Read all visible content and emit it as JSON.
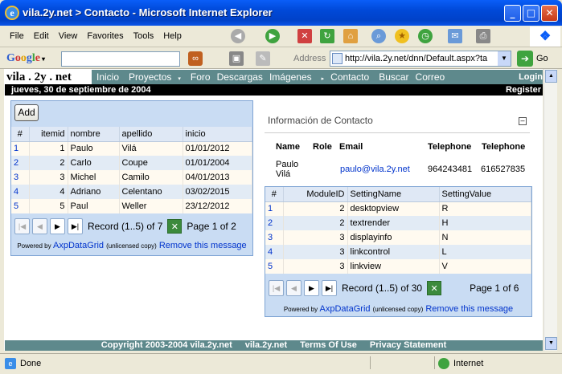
{
  "window": {
    "title": "vila.2y.net > Contacto - Microsoft Internet Explorer"
  },
  "menu": [
    "File",
    "Edit",
    "View",
    "Favorites",
    "Tools",
    "Help"
  ],
  "toolbar": {
    "google_label": "Google",
    "address_label": "Address",
    "address_value": "http://vila.2y.net/dnn/Default.aspx?ta",
    "go_label": "Go"
  },
  "site": {
    "name": "vila . 2y . net",
    "nav": [
      "Inicio",
      "Proyectos",
      "Foro",
      "Descargas",
      "Imágenes",
      "Contacto",
      "Buscar",
      "Correo"
    ],
    "login": "Login",
    "date": "jueves, 30 de septiembre de 2004",
    "register": "Register"
  },
  "left_grid": {
    "add_label": "Add",
    "columns": [
      "#",
      "itemid",
      "nombre",
      "apellido",
      "inicio"
    ],
    "rows": [
      [
        "1",
        "1",
        "Paulo",
        "Vilá",
        "01/01/2012"
      ],
      [
        "2",
        "2",
        "Carlo",
        "Coupe",
        "01/01/2004"
      ],
      [
        "3",
        "3",
        "Michel",
        "Camilo",
        "04/01/2013"
      ],
      [
        "4",
        "4",
        "Adriano",
        "Celentano",
        "03/02/2015"
      ],
      [
        "5",
        "5",
        "Paul",
        "Weller",
        "23/12/2012"
      ]
    ],
    "record_text": "Record (1..5) of 7",
    "page_text": "Page 1 of 2"
  },
  "powered": {
    "prefix": "Powered by",
    "product": "AxpDataGrid",
    "note": "(unlicensed copy)",
    "remove": "Remove this message"
  },
  "contact": {
    "title": "Información de Contacto",
    "headers": [
      "Name",
      "Role",
      "Email",
      "Telephone",
      "Telephone"
    ],
    "name_line1": "Paulo",
    "name_line2": "Vilá",
    "email": "paulo@vila.2y.net",
    "tel1": "964243481",
    "tel2": "616527835"
  },
  "right_grid": {
    "columns": [
      "#",
      "ModuleID",
      "SettingName",
      "SettingValue"
    ],
    "rows": [
      [
        "1",
        "2",
        "desktopview",
        "R"
      ],
      [
        "2",
        "2",
        "textrender",
        "H"
      ],
      [
        "3",
        "3",
        "displayinfo",
        "N"
      ],
      [
        "4",
        "3",
        "linkcontrol",
        "L"
      ],
      [
        "5",
        "3",
        "linkview",
        "V"
      ]
    ],
    "record_text": "Record (1..5) of 30",
    "page_text": "Page 1 of 6"
  },
  "footer": {
    "copyright": "Copyright 2003-2004 vila.2y.net",
    "site": "vila.2y.net",
    "terms": "Terms Of Use",
    "privacy": "Privacy Statement"
  },
  "status": {
    "left": "Done",
    "zone": "Internet"
  }
}
